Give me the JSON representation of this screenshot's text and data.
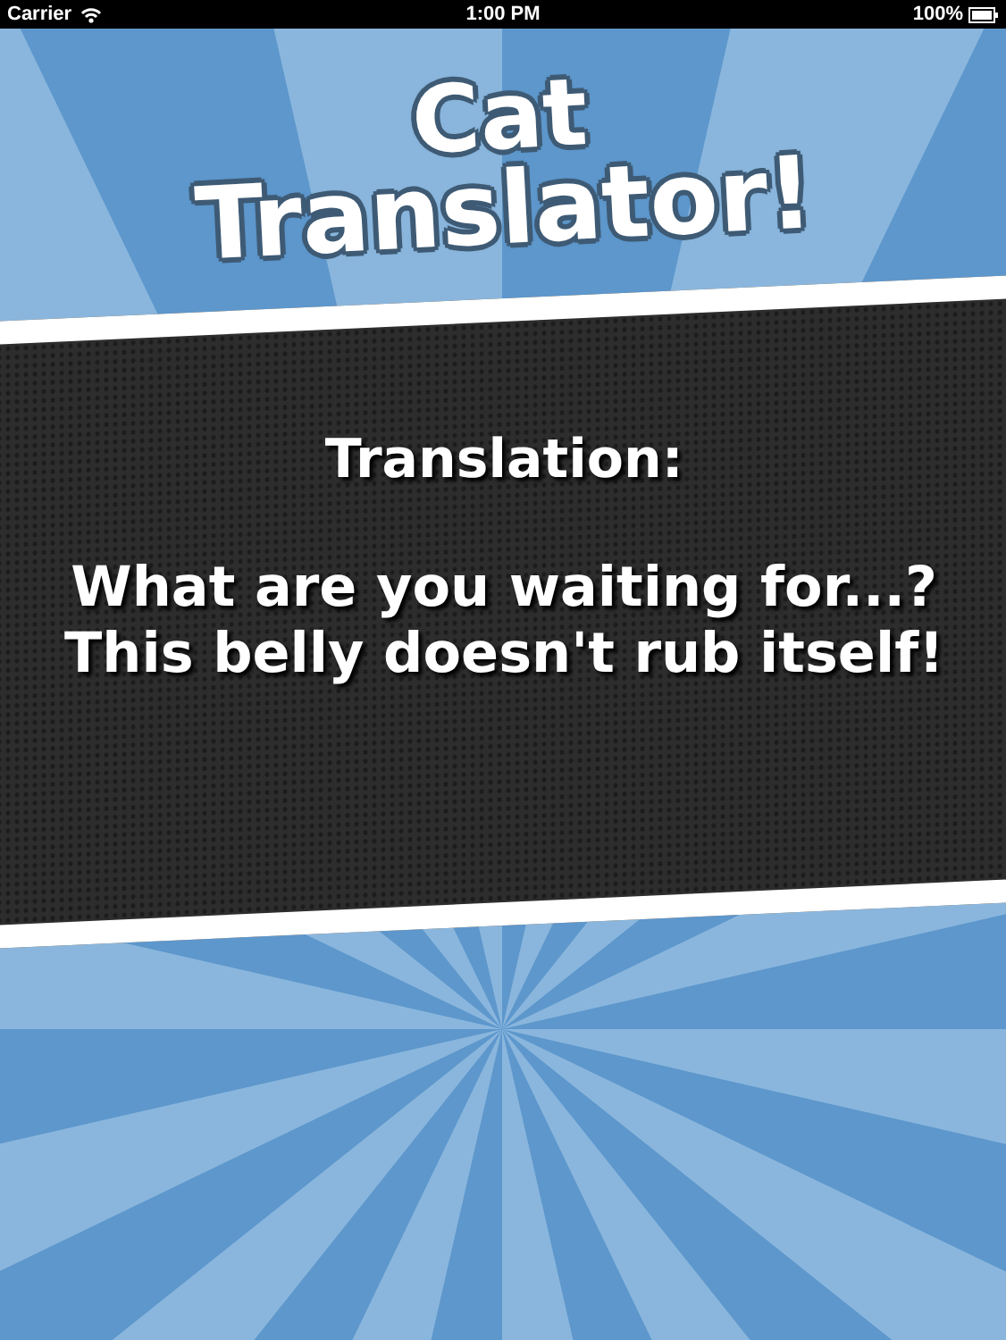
{
  "status_bar": {
    "carrier": "Carrier",
    "time": "1:00 PM",
    "battery": "100%"
  },
  "title": [
    "Cat",
    "Translator!"
  ],
  "translation": {
    "label": "Translation:",
    "lines": [
      "What are you waiting for...?",
      "This belly doesn't rub itself!"
    ]
  }
}
